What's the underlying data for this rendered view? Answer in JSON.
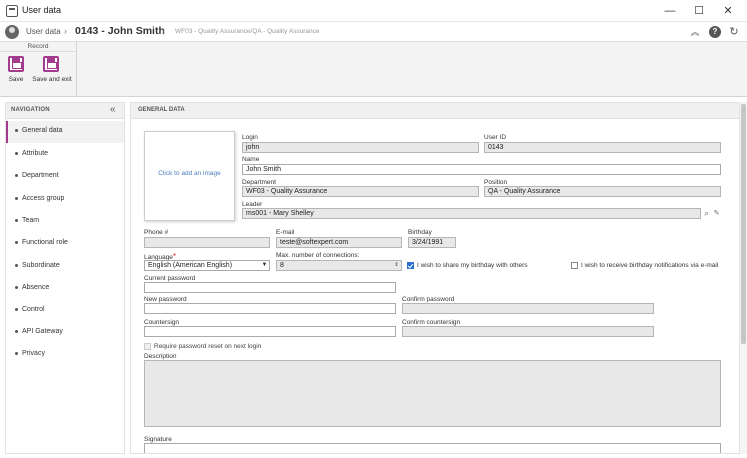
{
  "window": {
    "title": "User data",
    "minimize": "—",
    "maximize": "☐",
    "close": "✕"
  },
  "header": {
    "breadcrumb_root": "User data",
    "chevron": "›",
    "record_title": "0143 - John Smith",
    "separator": "|",
    "context": "WF03 - Quality Assurance/QA - Quality Assurance",
    "icons": [
      "collapse-up-icon",
      "help-icon",
      "refresh-icon"
    ],
    "collapse_glyph": "︽",
    "help_glyph": "?",
    "refresh_glyph": "↻"
  },
  "toolbar": {
    "group_label": "Record",
    "save_label": "Save",
    "save_exit_label": "Save and exit"
  },
  "navigation": {
    "title": "NAVIGATION",
    "collapse_glyph": "«",
    "items": [
      {
        "label": "General data",
        "active": true
      },
      {
        "label": "Attribute"
      },
      {
        "label": "Department"
      },
      {
        "label": "Access group"
      },
      {
        "label": "Team"
      },
      {
        "label": "Functional role"
      },
      {
        "label": "Subordinate"
      },
      {
        "label": "Absence"
      },
      {
        "label": "Control"
      },
      {
        "label": "API Gateway"
      },
      {
        "label": "Privacy"
      }
    ]
  },
  "general": {
    "section_title": "GENERAL DATA",
    "photo_hint": "Click to add an image",
    "login": {
      "label": "Login",
      "value": "john"
    },
    "user_id": {
      "label": "User ID",
      "value": "0143"
    },
    "name": {
      "label": "Name",
      "value": "John Smith"
    },
    "department": {
      "label": "Department",
      "value": "WF03 - Quality Assurance"
    },
    "position": {
      "label": "Position",
      "value": "QA - Quality Assurance"
    },
    "leader": {
      "label": "Leader",
      "value": "ms001 - Mary Shelley"
    },
    "phone": {
      "label": "Phone #",
      "value": ""
    },
    "email": {
      "label": "E-mail",
      "value": "teste@softexpert.com"
    },
    "birthday": {
      "label": "Birthday",
      "value": "3/24/1991"
    },
    "language": {
      "label": "Language",
      "required_mark": "*",
      "value": "English (American English)"
    },
    "max_connections": {
      "label": "Max. number of connections:",
      "value": "8"
    },
    "share_birthday": {
      "label": "I wish to share my birthday with others",
      "checked": true
    },
    "birthday_notifications": {
      "label": "I wish to receive birthday notifications via e-mail",
      "checked": false
    },
    "current_password": {
      "label": "Current password",
      "value": ""
    },
    "new_password": {
      "label": "New password",
      "value": ""
    },
    "confirm_password": {
      "label": "Confirm password",
      "value": ""
    },
    "countersign": {
      "label": "Countersign",
      "value": ""
    },
    "confirm_countersign": {
      "label": "Confirm countersign",
      "value": ""
    },
    "require_reset": {
      "label": "Require password reset on next login",
      "checked": false
    },
    "description": {
      "label": "Description",
      "value": ""
    },
    "signature": {
      "label": "Signature",
      "value": ""
    }
  },
  "colors": {
    "accent": "#a23a8d",
    "link": "#4a7fc1",
    "checkbox": "#2b6fcf"
  }
}
